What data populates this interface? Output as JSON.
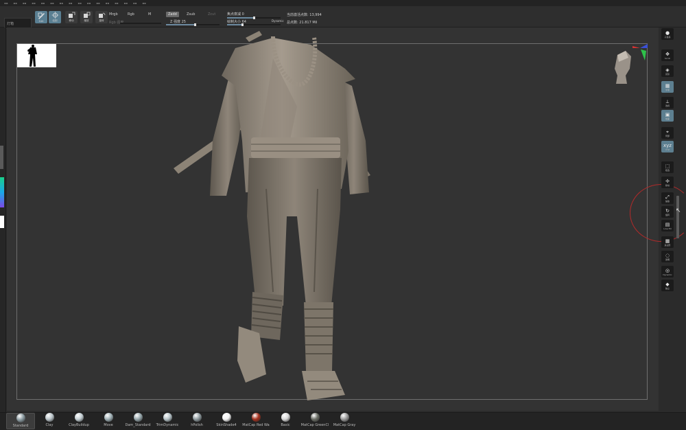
{
  "toolbar": {
    "search_placeholder": "灯箱",
    "tools": [
      {
        "id": "edit",
        "label": "Edit",
        "active": true,
        "icon": "edit-icon"
      },
      {
        "id": "draw",
        "label": "绘制",
        "active": true,
        "icon": "draw-icon"
      },
      {
        "id": "move",
        "label": "移动",
        "active": false,
        "icon": "move-icon"
      },
      {
        "id": "scale",
        "label": "缩放",
        "active": false,
        "icon": "scale-icon"
      },
      {
        "id": "rotate",
        "label": "旋转",
        "active": false,
        "icon": "rotate-icon"
      }
    ],
    "mrgb": "Mrgb",
    "rgb": "Rgb",
    "m": "M",
    "rgb_intensity": "Rgb 强度",
    "zadd": "Zadd",
    "zsub": "Zsub",
    "zcut": "Zcut",
    "z_intensity": "Z 强度 25",
    "focal_shift": "焦点衰减 0",
    "draw_size": "绘制大小 64",
    "dynamic": "Dynamic",
    "active_points": "当前激活点数: 13,994",
    "total_points": "总点数: 21.817 Mil"
  },
  "right_shelf": [
    {
      "name": "subtool-sphere",
      "label": "子造基",
      "icon": "sphere-icon",
      "active": false
    },
    {
      "name": "scroll",
      "label": "Scroll",
      "icon": "scroll-icon",
      "active": false
    },
    {
      "name": "actual",
      "label": "实际",
      "icon": "actual-icon",
      "active": false
    },
    {
      "name": "aahalf",
      "label": "半率",
      "icon": "aahalf-icon",
      "active": true
    },
    {
      "name": "persp",
      "label": "透视",
      "icon": "persp-icon",
      "active": false
    },
    {
      "name": "floor",
      "label": "地面",
      "icon": "floor-icon",
      "active": true
    },
    {
      "name": "local",
      "label": "局部",
      "icon": "local-icon",
      "active": false
    },
    {
      "name": "xyz",
      "label": "XYZ",
      "icon": "xyz-icon",
      "active": true
    },
    {
      "name": "frame",
      "label": "框选",
      "icon": "frame-icon",
      "active": false
    },
    {
      "name": "move-view",
      "label": "移动",
      "icon": "move-view-icon",
      "active": false
    },
    {
      "name": "scale-view",
      "label": "缩放",
      "icon": "scale-view-icon",
      "active": false
    },
    {
      "name": "rotate-view",
      "label": "旋转",
      "icon": "rotate-view-icon",
      "active": false
    },
    {
      "name": "linefill",
      "label": "Line Fill",
      "icon": "linefill-icon",
      "active": false
    },
    {
      "name": "polyf",
      "label": "多边形",
      "icon": "polyf-icon",
      "active": false
    },
    {
      "name": "transp",
      "label": "透明",
      "icon": "transp-icon",
      "active": false
    },
    {
      "name": "dynamic-view",
      "label": "Dynamic",
      "icon": "dynamic-icon",
      "active": false
    },
    {
      "name": "solo",
      "label": "独立",
      "icon": "solo-icon",
      "active": false
    }
  ],
  "materials": [
    {
      "label": "Standard",
      "color": "#8a9aa0",
      "selected": true
    },
    {
      "label": "Clay",
      "color": "#b9c3c8",
      "selected": false
    },
    {
      "label": "ClayBuildup",
      "color": "#c3ced3",
      "selected": false
    },
    {
      "label": "Move",
      "color": "#9fb0b5",
      "selected": false
    },
    {
      "label": "Dam_Standard",
      "color": "#95a5aa",
      "selected": false
    },
    {
      "label": "TrimDynamic",
      "color": "#b4c1c6",
      "selected": false
    },
    {
      "label": "hPolish",
      "color": "#8e9a9e",
      "selected": false
    },
    {
      "label": "SkinShade4",
      "color": "#f2f2f2",
      "selected": false
    },
    {
      "label": "MatCap Red Wa",
      "color": "#a6321f",
      "selected": false
    },
    {
      "label": "Basic",
      "color": "#d8d8d8",
      "selected": false
    },
    {
      "label": "MatCap GreenCl",
      "color": "#6b6e66",
      "selected": false
    },
    {
      "label": "MatCap Gray",
      "color": "#9a9a9a",
      "selected": false
    }
  ]
}
